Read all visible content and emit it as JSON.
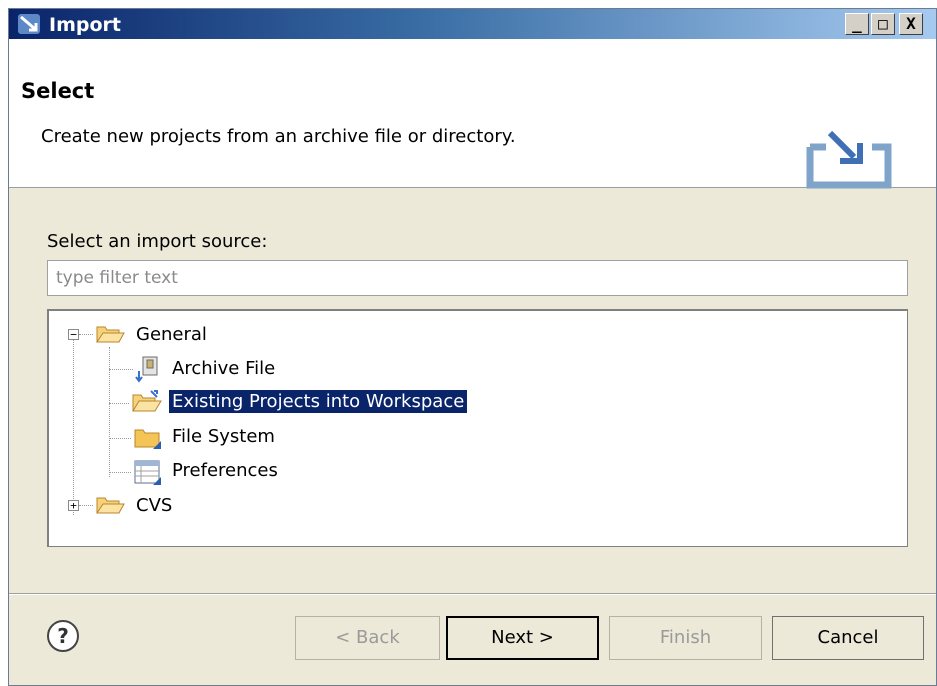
{
  "window": {
    "title": "Import",
    "controls": {
      "minimize": "_",
      "maximize": "□",
      "close": "X"
    }
  },
  "header": {
    "title": "Select",
    "description": "Create new projects from an archive file or directory."
  },
  "body": {
    "source_label": "Select an import source:",
    "filter_placeholder": "type filter text",
    "filter_value": "",
    "tree": [
      {
        "label": "General",
        "expanded": true,
        "icon": "folder-open-icon"
      },
      {
        "label": "Archive File",
        "icon": "archive-file-icon"
      },
      {
        "label": "Existing Projects into Workspace",
        "icon": "existing-projects-icon",
        "selected": true
      },
      {
        "label": "File System",
        "icon": "file-system-folder-icon"
      },
      {
        "label": "Preferences",
        "icon": "preferences-icon"
      },
      {
        "label": "CVS",
        "expanded": false,
        "icon": "folder-open-icon"
      }
    ]
  },
  "footer": {
    "help": "?",
    "back_label": "< Back",
    "next_label": "Next >",
    "finish_label": "Finish",
    "cancel_label": "Cancel"
  },
  "colors": {
    "selection": "#0a246a",
    "dialog_bg": "#ece9d8",
    "folder": "#f4c456"
  }
}
